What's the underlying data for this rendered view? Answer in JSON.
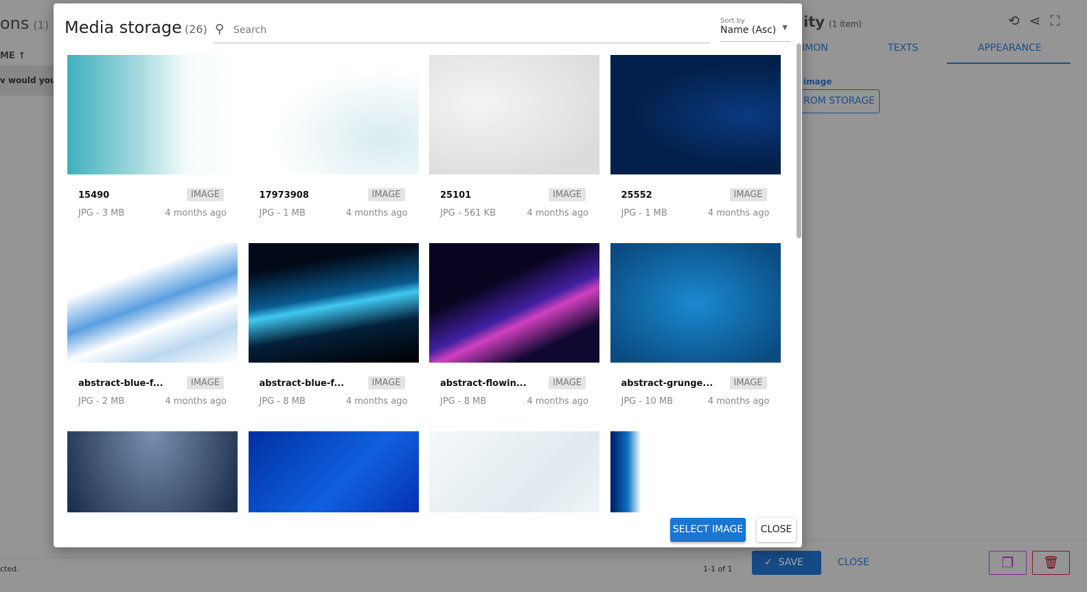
{
  "background_left": {
    "title": "ons",
    "count": "(1)",
    "column": "ME ↑",
    "row_text": "v would you r",
    "footer_left": "cted.",
    "pagination": "1-1 of 1"
  },
  "background_right": {
    "title": "ity",
    "count": "(1 item)",
    "tabs": [
      "IMON",
      "TEXTS",
      "APPEARANCE"
    ],
    "image_label": "image",
    "from_storage": "ROM STORAGE",
    "save": "SAVE",
    "close": "CLOSE",
    "icons": [
      "history-icon",
      "share-icon",
      "fullscreen-icon",
      "copy-icon",
      "delete-icon"
    ]
  },
  "modal": {
    "title": "Media storage",
    "count": "(26)",
    "search_placeholder": "Search",
    "sort_label": "Sort by",
    "sort_value": "Name (Asc)",
    "select_button": "SELECT IMAGE",
    "close_button": "CLOSE",
    "items": [
      {
        "name": "15490",
        "type": "IMAGE",
        "meta": "JPG - 3 MB",
        "age": "4 months ago"
      },
      {
        "name": "17973908",
        "type": "IMAGE",
        "meta": "JPG - 1 MB",
        "age": "4 months ago"
      },
      {
        "name": "25101",
        "type": "IMAGE",
        "meta": "JPG - 561 KB",
        "age": "4 months ago"
      },
      {
        "name": "25552",
        "type": "IMAGE",
        "meta": "JPG - 1 MB",
        "age": "4 months ago"
      },
      {
        "name": "abstract-blue-f...",
        "type": "IMAGE",
        "meta": "JPG - 2 MB",
        "age": "4 months ago"
      },
      {
        "name": "abstract-blue-f...",
        "type": "IMAGE",
        "meta": "JPG - 8 MB",
        "age": "4 months ago"
      },
      {
        "name": "abstract-flowin...",
        "type": "IMAGE",
        "meta": "JPG - 8 MB",
        "age": "4 months ago"
      },
      {
        "name": "abstract-grunge...",
        "type": "IMAGE",
        "meta": "JPG - 10 MB",
        "age": "4 months ago"
      },
      {},
      {},
      {},
      {}
    ]
  }
}
